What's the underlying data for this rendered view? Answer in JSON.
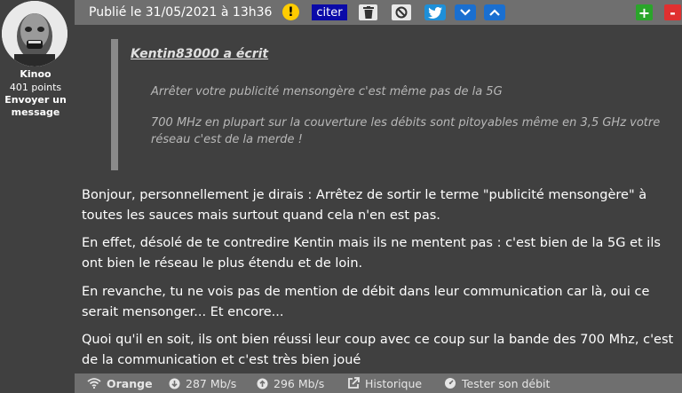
{
  "user": {
    "name": "Kinoo",
    "points": "401 points",
    "send_message": "Envoyer un message"
  },
  "header": {
    "posted": "Publié le 31/05/2021 à 13h36",
    "warn_icon": "!",
    "quote_button": "citer",
    "plus_label": "+",
    "minus_label": "-"
  },
  "quote": {
    "author": "Kentin83000 a écrit",
    "paragraphs": [
      "Arrêter votre publicité mensongère c'est même pas de la 5G",
      "700 MHz en plupart sur la couverture les débits sont pitoyables même en 3,5 GHz votre réseau c'est de la merde !"
    ]
  },
  "body": {
    "paragraphs": [
      "Bonjour, personnellement je dirais : Arrêtez de sortir le terme \"publicité mensongère\" à toutes les sauces mais surtout quand cela n'en est pas.",
      "En effet, désolé de te contredire Kentin mais ils ne mentent pas : c'est bien de la 5G et ils ont bien le réseau le plus étendu et de loin.",
      "En revanche, tu ne vois pas de mention de débit dans leur communication car là, oui ce serait mensonger... Et encore...",
      "Quoi qu'il en soit, ils ont bien réussi leur coup avec ce coup sur la bande des 700 Mhz, c'est de la communication et c'est très bien joué"
    ]
  },
  "footer": {
    "operator": "Orange",
    "download": "287 Mb/s",
    "upload": "296 Mb/s",
    "history": "Historique",
    "test": "Tester son débit"
  },
  "colors": {
    "background": "#404040",
    "bar": "#6f6f6f",
    "citer": "#0a0aa8",
    "twitter": "#1e8fd8",
    "vote_plus": "#2aa52a",
    "vote_minus": "#e03030"
  },
  "icons": [
    "warning-icon",
    "trash-icon",
    "ban-icon",
    "twitter-icon",
    "chevron-down-icon",
    "chevron-up-icon",
    "wifi-icon",
    "download-icon",
    "upload-icon",
    "external-link-icon",
    "speedometer-icon"
  ]
}
